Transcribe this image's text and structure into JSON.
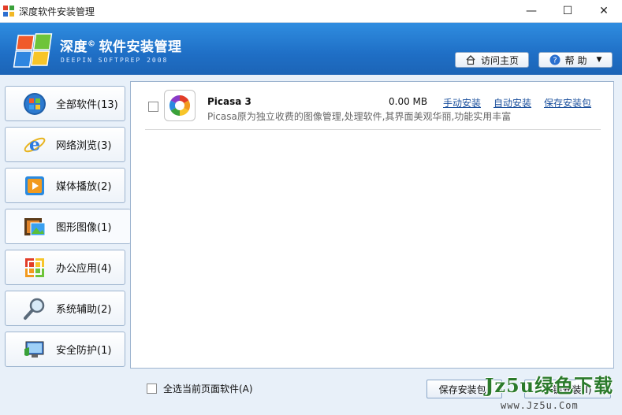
{
  "window": {
    "title": "深度软件安装管理",
    "controls": {
      "minimize": "—",
      "maximize": "☐",
      "close": "✕"
    }
  },
  "header": {
    "brand_name": "深度",
    "brand_mark": "©",
    "brand_title": "软件安装管理",
    "brand_sub": "DEEPIN SOFTPREP 2008",
    "visit_home": "访问主页",
    "help": "帮 助"
  },
  "sidebar": {
    "items": [
      {
        "label": "全部软件(13)",
        "icon": "windows-orb-icon"
      },
      {
        "label": "网络浏览(3)",
        "icon": "ie-icon"
      },
      {
        "label": "媒体播放(2)",
        "icon": "media-player-icon"
      },
      {
        "label": "图形图像(1)",
        "icon": "film-photo-icon",
        "active": true
      },
      {
        "label": "办公应用(4)",
        "icon": "office-icon"
      },
      {
        "label": "系统辅助(2)",
        "icon": "magnifier-icon"
      },
      {
        "label": "安全防护(1)",
        "icon": "security-icon"
      }
    ]
  },
  "main": {
    "apps": [
      {
        "name": "Picasa 3",
        "size": "0.00 MB",
        "manual_install": "手动安装",
        "auto_install": "自动安装",
        "save_package": "保存安装包",
        "description": "Picasa原为独立收费的图像管理,处理软件,其界面美观华丽,功能实用丰富"
      }
    ]
  },
  "footer": {
    "select_all": "全选当前页面软件(A)",
    "save_button": "保存安装包(",
    "install_button": "一键安装(I)"
  },
  "watermark": {
    "main": "Jz5u绿色下载",
    "sub": "www.Jz5u.Com"
  },
  "colors": {
    "header_blue": "#1f6fc6",
    "link_blue": "#1a4f9c",
    "watermark_green": "#2b7a2b"
  }
}
